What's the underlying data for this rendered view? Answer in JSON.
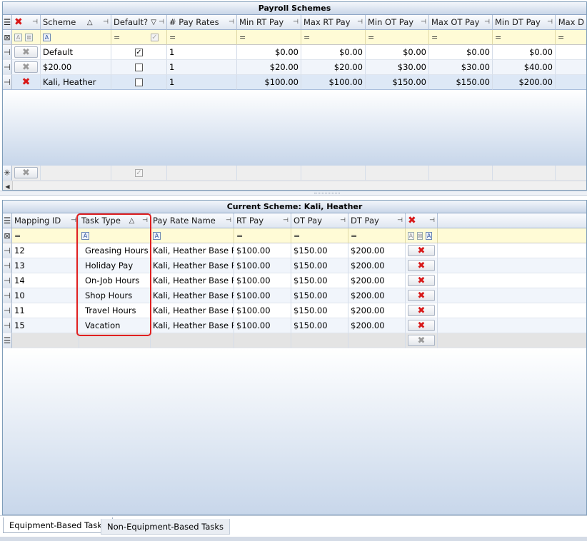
{
  "top_grid": {
    "title": "Payroll Schemes",
    "columns": [
      {
        "label": "Scheme",
        "sort": "△"
      },
      {
        "label": "Default?",
        "sort": "▽"
      },
      {
        "label": "# Pay Rates"
      },
      {
        "label": "Min RT Pay"
      },
      {
        "label": "Max RT Pay"
      },
      {
        "label": "Min OT Pay"
      },
      {
        "label": "Max OT Pay"
      },
      {
        "label": "Min DT Pay"
      },
      {
        "label": "Max D"
      }
    ],
    "rows": [
      {
        "scheme": "Default",
        "default": true,
        "pay_rates": "1",
        "min_rt": "$0.00",
        "max_rt": "$0.00",
        "min_ot": "$0.00",
        "max_ot": "$0.00",
        "min_dt": "$0.00"
      },
      {
        "scheme": "$20.00",
        "default": false,
        "pay_rates": "1",
        "min_rt": "$20.00",
        "max_rt": "$20.00",
        "min_ot": "$30.00",
        "max_ot": "$30.00",
        "min_dt": "$40.00"
      },
      {
        "scheme": "Kali, Heather",
        "default": false,
        "pay_rates": "1",
        "min_rt": "$100.00",
        "max_rt": "$100.00",
        "min_ot": "$150.00",
        "max_ot": "$150.00",
        "min_dt": "$200.00"
      }
    ]
  },
  "bottom_grid": {
    "title": "Current Scheme: Kali, Heather",
    "columns": [
      {
        "label": "Mapping ID"
      },
      {
        "label": "Task Type",
        "sort": "△"
      },
      {
        "label": "Pay Rate Name"
      },
      {
        "label": "RT Pay"
      },
      {
        "label": "OT Pay"
      },
      {
        "label": "DT Pay"
      }
    ],
    "rows": [
      {
        "id": "12",
        "task": "Greasing Hours",
        "rate": "Kali, Heather Base R",
        "rt": "$100.00",
        "ot": "$150.00",
        "dt": "$200.00"
      },
      {
        "id": "13",
        "task": "Holiday Pay",
        "rate": "Kali, Heather Base R",
        "rt": "$100.00",
        "ot": "$150.00",
        "dt": "$200.00"
      },
      {
        "id": "14",
        "task": "On-Job Hours",
        "rate": "Kali, Heather Base R",
        "rt": "$100.00",
        "ot": "$150.00",
        "dt": "$200.00"
      },
      {
        "id": "10",
        "task": "Shop Hours",
        "rate": "Kali, Heather Base R",
        "rt": "$100.00",
        "ot": "$150.00",
        "dt": "$200.00"
      },
      {
        "id": "11",
        "task": "Travel Hours",
        "rate": "Kali, Heather Base R",
        "rt": "$100.00",
        "ot": "$150.00",
        "dt": "$200.00"
      },
      {
        "id": "15",
        "task": "Vacation",
        "rate": "Kali, Heather Base R",
        "rt": "$100.00",
        "ot": "$150.00",
        "dt": "$200.00"
      }
    ]
  },
  "tabs": [
    {
      "label": "Equipment-Based Tasks",
      "active": true
    },
    {
      "label": "Non-Equipment-Based Tasks",
      "active": false
    }
  ],
  "colors": {
    "accent_red": "#d81818",
    "header_blue": "#c9d6e8",
    "filter_yellow": "#fffbd6",
    "highlight": "#e02020"
  }
}
